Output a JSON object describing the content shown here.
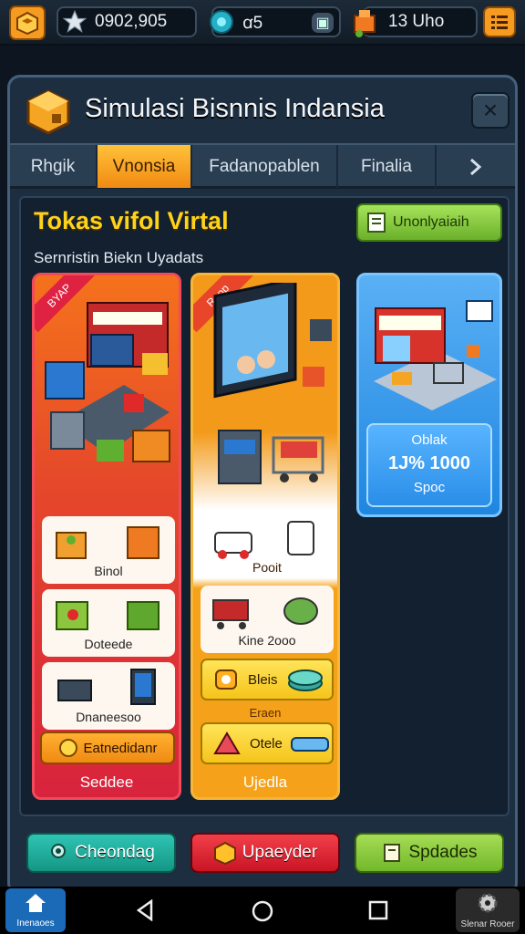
{
  "topbar": {
    "coins": "0902,905",
    "gems": "ꭤ5",
    "energy": "13 Uho"
  },
  "panel": {
    "title": "Simulasi Bisnnis Indansia",
    "close": "×"
  },
  "tabs": [
    {
      "label": "Rhgik",
      "active": false
    },
    {
      "label": "Vnonsia",
      "active": true
    },
    {
      "label": "Fadanopablen",
      "active": false
    },
    {
      "label": "Finalia",
      "active": false
    }
  ],
  "store": {
    "title": "Tokas vifol Virtal",
    "subtitle": "Sernristin Biekn Uyadats",
    "top_button": "Unonlyaiaih",
    "card_left": {
      "ribbon": "BYAP",
      "tiles": [
        "Binol",
        "Doteede",
        "Dnaneesoo"
      ],
      "action": "Eatnedidanr",
      "footer": "Seddee"
    },
    "card_mid": {
      "ribbon": "Raop",
      "tiles": [
        "Pooit",
        "Kine 2ooo"
      ],
      "rows": [
        "Bleis",
        "Otele"
      ],
      "sublabel": "Eraen",
      "footer": "Ujedla"
    },
    "card_right": {
      "line1": "Oblak",
      "line2": "1J% 1000",
      "line3": "Spoc"
    }
  },
  "bottom_buttons": [
    "Cheondag",
    "Upaeyder",
    "Spdades"
  ],
  "navbar": {
    "left_label": "Inenaoes",
    "right_label": "Slenar Rooer"
  },
  "colors": {
    "accent_orange": "#f39a1a",
    "teal_button": "#1fa99b",
    "red_button": "#e02a36",
    "green_button": "#8cc63f",
    "blue_card": "#1f86e0"
  }
}
